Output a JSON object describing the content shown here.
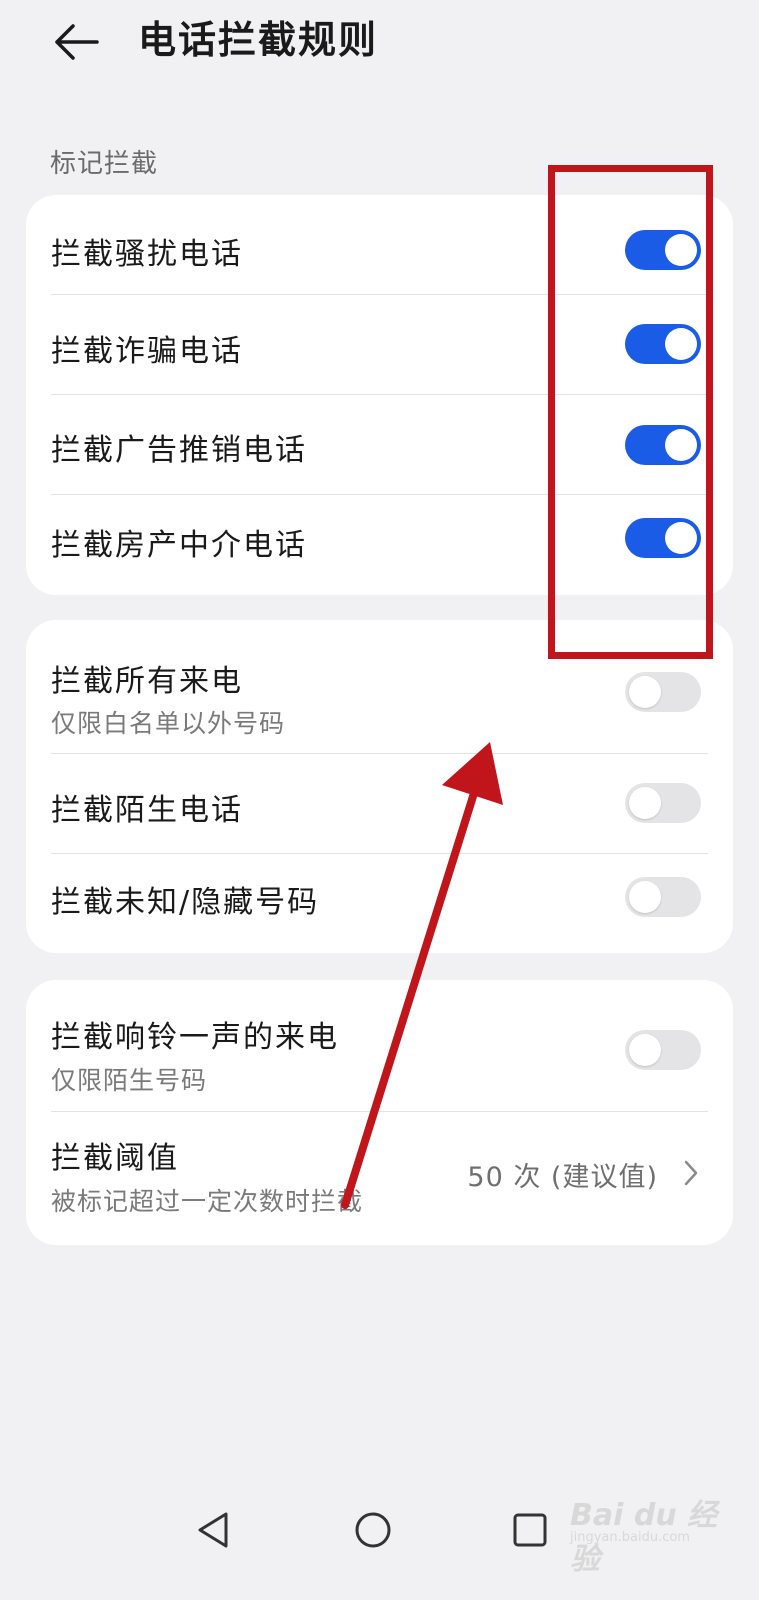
{
  "header": {
    "title": "电话拦截规则",
    "back_icon": "arrow-left-icon"
  },
  "section_title": "标记拦截",
  "card1": {
    "items": [
      {
        "label": "拦截骚扰电话",
        "toggle": "on"
      },
      {
        "label": "拦截诈骗电话",
        "toggle": "on"
      },
      {
        "label": "拦截广告推销电话",
        "toggle": "on"
      },
      {
        "label": "拦截房产中介电话",
        "toggle": "on"
      }
    ]
  },
  "card2": {
    "items": [
      {
        "label": "拦截所有来电",
        "sublabel": "仅限白名单以外号码",
        "toggle": "off"
      },
      {
        "label": "拦截陌生电话",
        "toggle": "off"
      },
      {
        "label": "拦截未知/隐藏号码",
        "toggle": "off"
      }
    ]
  },
  "card3": {
    "ring_once": {
      "label": "拦截响铃一声的来电",
      "sublabel": "仅限陌生号码",
      "toggle": "off"
    },
    "threshold": {
      "label": "拦截阈值",
      "sublabel": "被标记超过一定次数时拦截",
      "value": "50 次 (建议值)",
      "chevron_icon": "chevron-right-icon"
    }
  },
  "navbar": {
    "icons": [
      "back-triangle-icon",
      "home-circle-icon",
      "recents-square-icon"
    ]
  },
  "watermark": {
    "logo": "Bai du 经验",
    "url": "jingyan.baidu.com"
  },
  "colors": {
    "accent": "#1a5ce6",
    "annotation": "#c0151a",
    "background": "#f1f1f3"
  }
}
